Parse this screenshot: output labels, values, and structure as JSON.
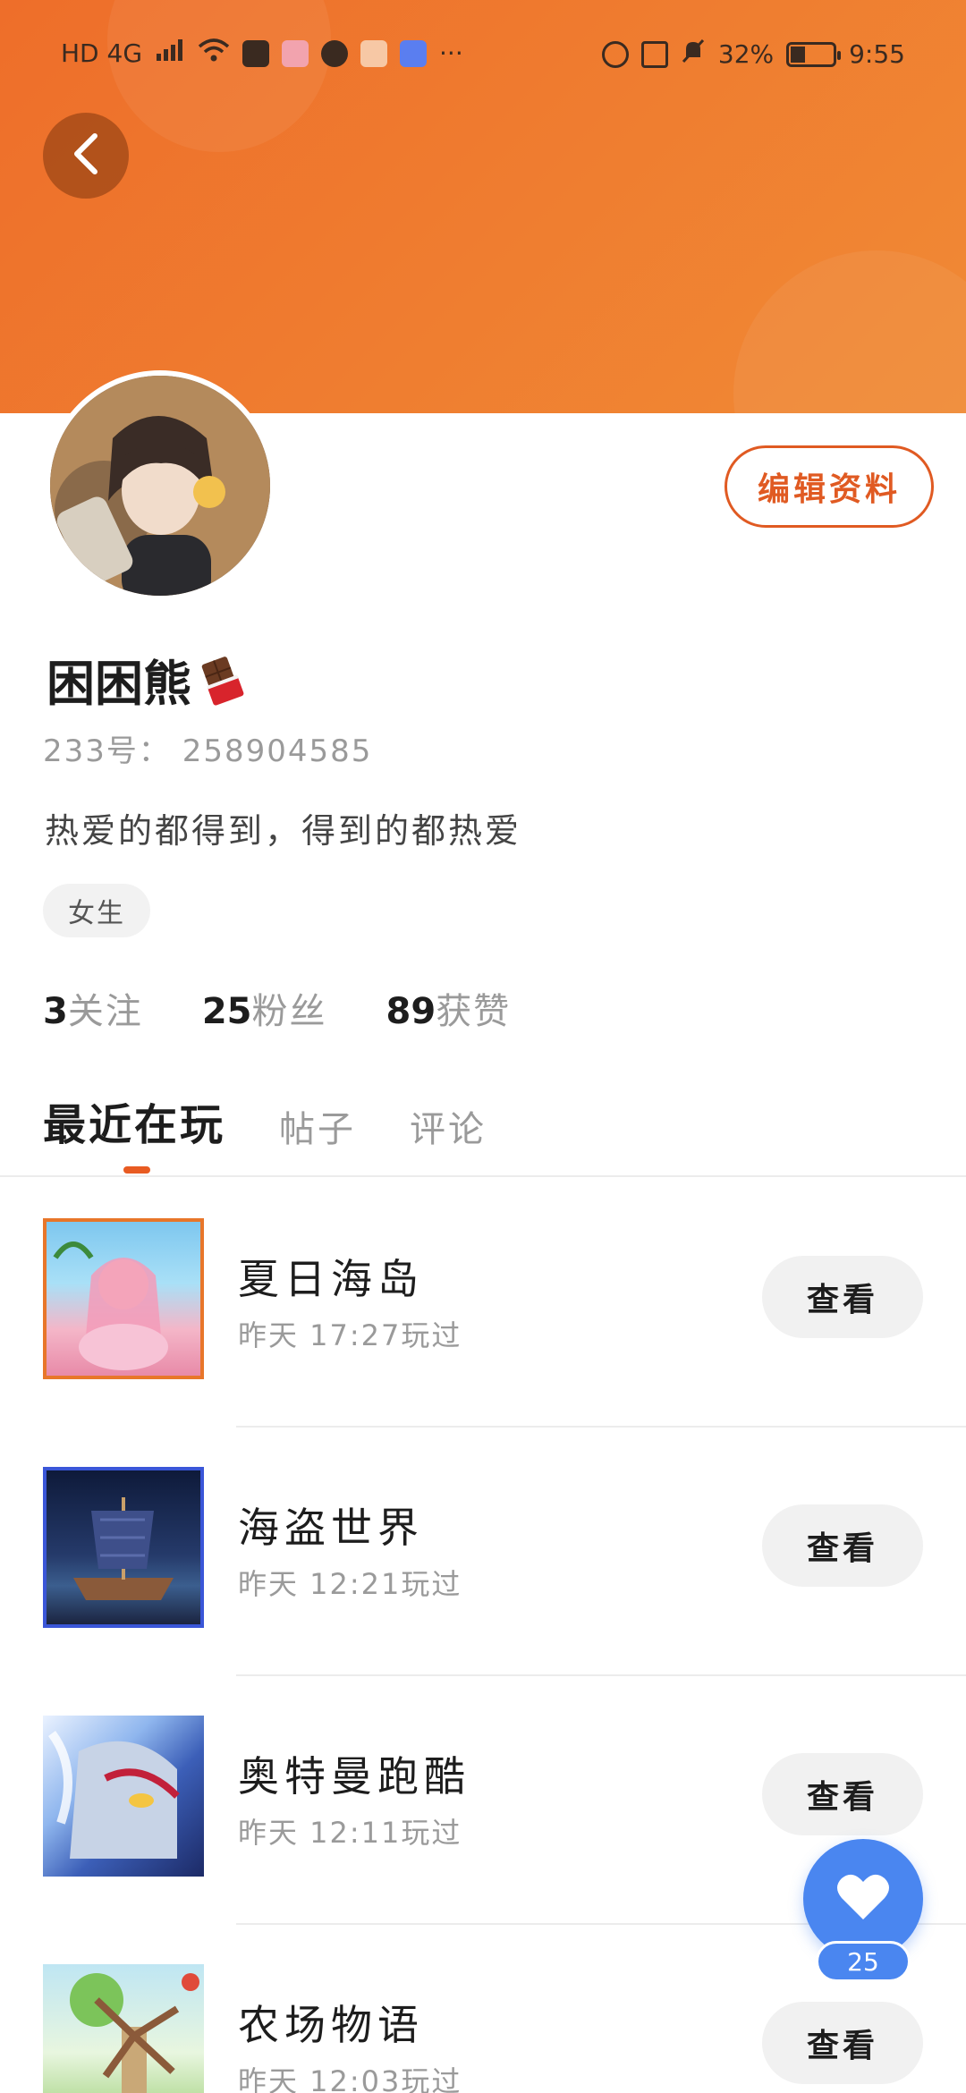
{
  "status_bar": {
    "left_text": "HD 4G",
    "battery": "32%",
    "battery_level": 0.32,
    "time": "9:55",
    "more": "···"
  },
  "profile": {
    "nickname": "困困熊",
    "uid": "233号： 258904585",
    "bio": "热爱的都得到，得到的都热爱",
    "gender_tag": "女生",
    "edit_label": "编辑资料"
  },
  "stats": [
    {
      "num": "3",
      "label": "关注"
    },
    {
      "num": "25",
      "label": "粉丝"
    },
    {
      "num": "89",
      "label": "获赞"
    }
  ],
  "tabs": [
    {
      "label": "最近在玩"
    },
    {
      "label": "帖子"
    },
    {
      "label": "评论"
    }
  ],
  "games": [
    {
      "name": "夏日海岛",
      "time": "昨天 17:27玩过",
      "button": "查看"
    },
    {
      "name": "海盗世界",
      "time": "昨天 12:21玩过",
      "button": "查看"
    },
    {
      "name": "奥特曼跑酷",
      "time": "昨天 12:11玩过",
      "button": "查看"
    },
    {
      "name": "农场物语",
      "time": "昨天 12:03玩过",
      "button": "查看"
    }
  ],
  "favorite": {
    "count": "25"
  },
  "colors": {
    "header_orange": "#ee6e2a",
    "accent": "#e05a22",
    "fab_blue": "#4a86f0"
  }
}
